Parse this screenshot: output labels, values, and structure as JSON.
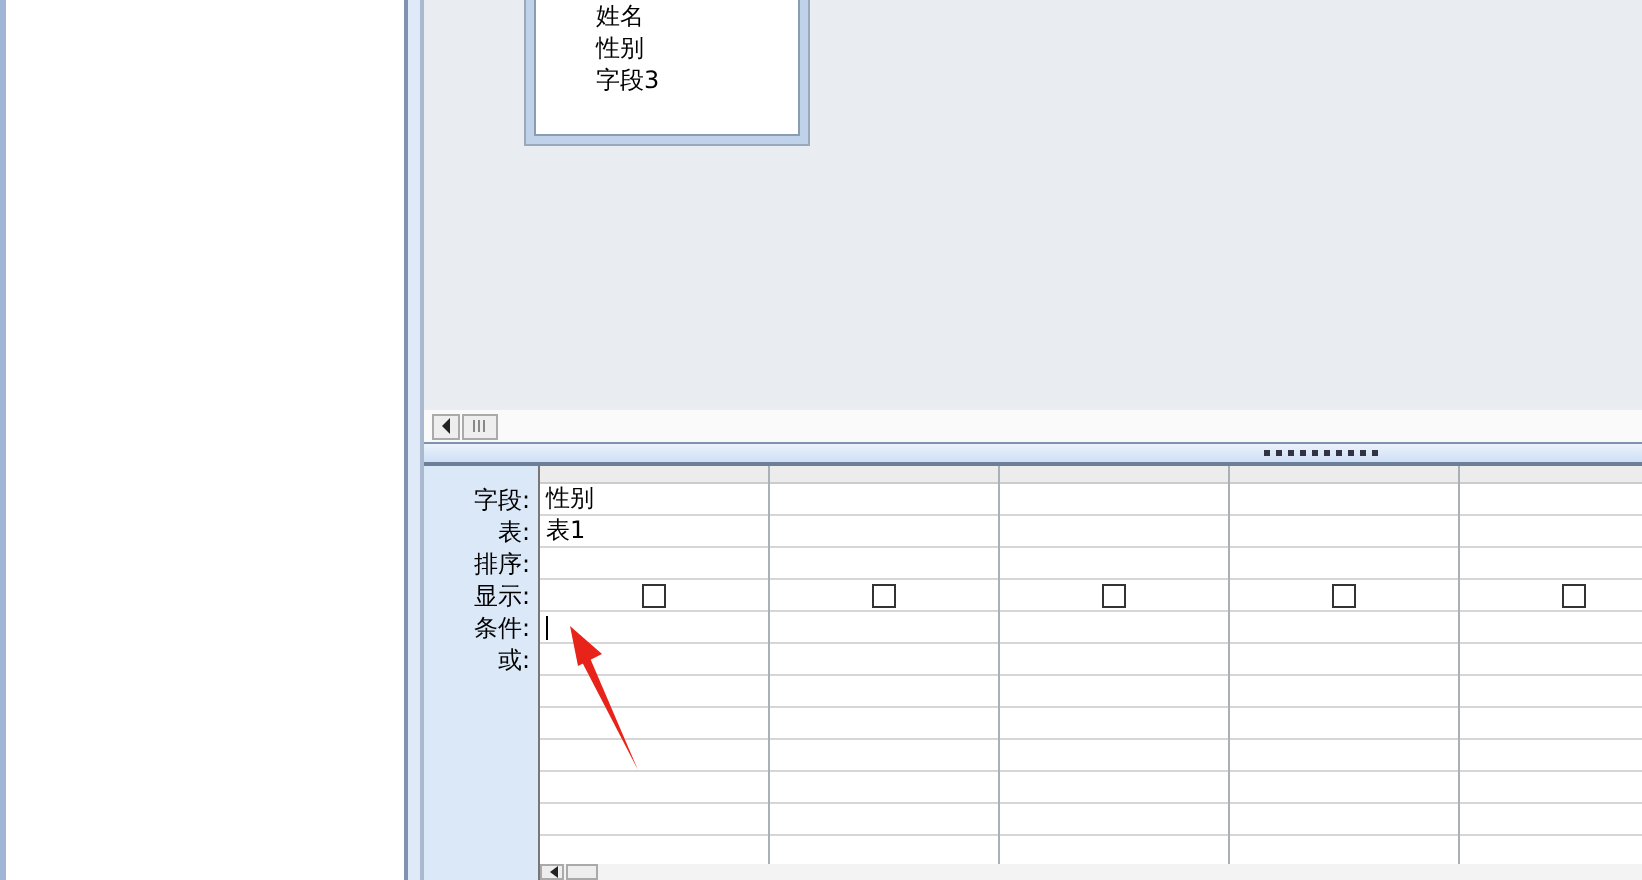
{
  "table_box": {
    "fields": [
      "姓名",
      "性别",
      "字段3"
    ]
  },
  "grid": {
    "row_labels": [
      "字段:",
      "表:",
      "排序:",
      "显示:",
      "条件:",
      "或:"
    ],
    "columns": [
      {
        "field": "性别",
        "table": "表1",
        "show": false,
        "cursor": true
      },
      {
        "show": false,
        "cursor": false
      },
      {
        "show": false,
        "cursor": false
      },
      {
        "show": false,
        "cursor": false
      },
      {
        "show": false,
        "cursor": false
      }
    ]
  },
  "annotation": {
    "kind": "arrow"
  }
}
